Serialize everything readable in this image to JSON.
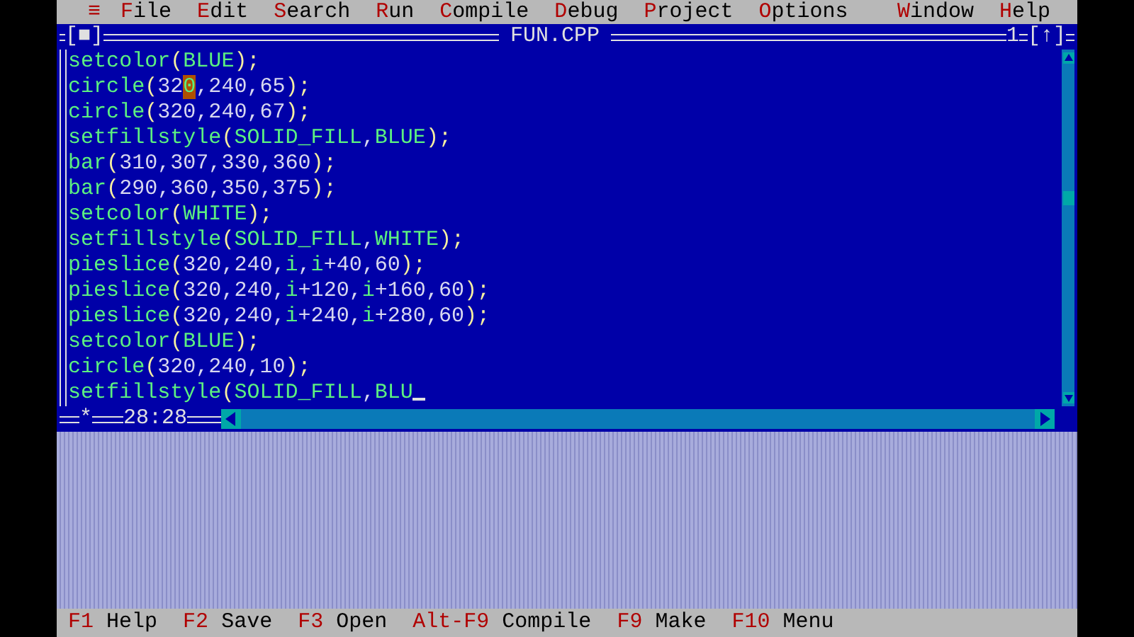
{
  "menu_bar": {
    "system_menu": "≡",
    "items": [
      {
        "hotkey": "F",
        "rest": "ile"
      },
      {
        "hotkey": "E",
        "rest": "dit"
      },
      {
        "hotkey": "S",
        "rest": "earch"
      },
      {
        "hotkey": "R",
        "rest": "un"
      },
      {
        "hotkey": "C",
        "rest": "ompile"
      },
      {
        "hotkey": "D",
        "rest": "ebug"
      },
      {
        "hotkey": "P",
        "rest": "roject"
      },
      {
        "hotkey": "O",
        "rest": "ptions"
      }
    ],
    "right_items": [
      {
        "hotkey": "W",
        "rest": "indow"
      },
      {
        "hotkey": "H",
        "rest": "elp"
      }
    ]
  },
  "editor": {
    "close_box": "[■]",
    "title": "FUN.CPP",
    "window_number": "1",
    "zoom_box": "[↑]",
    "modified_marker": "*",
    "position": "28:28",
    "lines": [
      {
        "text": "setcolor(BLUE);"
      },
      {
        "text": "circle(32",
        "highlight": "0",
        "after": ",240,65);"
      },
      {
        "text": "circle(320,240,67);"
      },
      {
        "text": "setfillstyle(SOLID_FILL,BLUE);"
      },
      {
        "text": "bar(310,307,330,360);"
      },
      {
        "text": "bar(290,360,350,375);"
      },
      {
        "text": "setcolor(WHITE);"
      },
      {
        "text": "setfillstyle(SOLID_FILL,WHITE);"
      },
      {
        "text": "pieslice(320,240,i,i+40,60);"
      },
      {
        "text": "pieslice(320,240,i+120,i+160,60);"
      },
      {
        "text": "pieslice(320,240,i+240,i+280,60);"
      },
      {
        "text": "setcolor(BLUE);"
      },
      {
        "text": "circle(320,240,10);"
      },
      {
        "text": "setfillstyle(SOLID_FILL,BLU",
        "cursor": true
      }
    ]
  },
  "status_bar": [
    {
      "key": "F1",
      "label": "Help"
    },
    {
      "key": "F2",
      "label": "Save"
    },
    {
      "key": "F3",
      "label": "Open"
    },
    {
      "key": "Alt-F9",
      "label": "Compile"
    },
    {
      "key": "F9",
      "label": "Make"
    },
    {
      "key": "F10",
      "label": "Menu"
    }
  ]
}
